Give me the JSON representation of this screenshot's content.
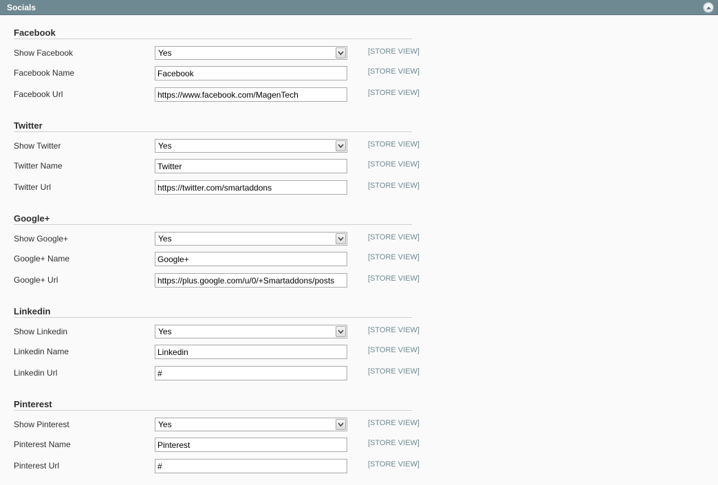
{
  "panel": {
    "title": "Socials"
  },
  "sections": [
    {
      "title": "Facebook",
      "show_label": "Show Facebook",
      "show_value": "Yes",
      "name_label": "Facebook Name",
      "name_value": "Facebook",
      "url_label": "Facebook Url",
      "url_value": "https://www.facebook.com/MagenTech",
      "scope": "[STORE VIEW]"
    },
    {
      "title": "Twitter",
      "show_label": "Show Twitter",
      "show_value": "Yes",
      "name_label": "Twitter Name",
      "name_value": "Twitter",
      "url_label": "Twitter Url",
      "url_value": "https://twitter.com/smartaddons",
      "scope": "[STORE VIEW]"
    },
    {
      "title": "Google+",
      "show_label": "Show Google+",
      "show_value": "Yes",
      "name_label": "Google+ Name",
      "name_value": "Google+",
      "url_label": "Google+ Url",
      "url_value": "https://plus.google.com/u/0/+Smartaddons/posts",
      "scope": "[STORE VIEW]"
    },
    {
      "title": "Linkedin",
      "show_label": "Show Linkedin",
      "show_value": "Yes",
      "name_label": "Linkedin Name",
      "name_value": "Linkedin",
      "url_label": "Linkedin Url",
      "url_value": "#",
      "scope": "[STORE VIEW]"
    },
    {
      "title": "Pinterest",
      "show_label": "Show Pinterest",
      "show_value": "Yes",
      "name_label": "Pinterest Name",
      "name_value": "Pinterest",
      "url_label": "Pinterest Url",
      "url_value": "#",
      "scope": "[STORE VIEW]"
    }
  ],
  "icons": {
    "collapse": "collapse-up-icon",
    "dropdown": "chevron-down-icon"
  },
  "colors": {
    "header_bg": "#6f8992",
    "scope_text": "#6f8992"
  }
}
